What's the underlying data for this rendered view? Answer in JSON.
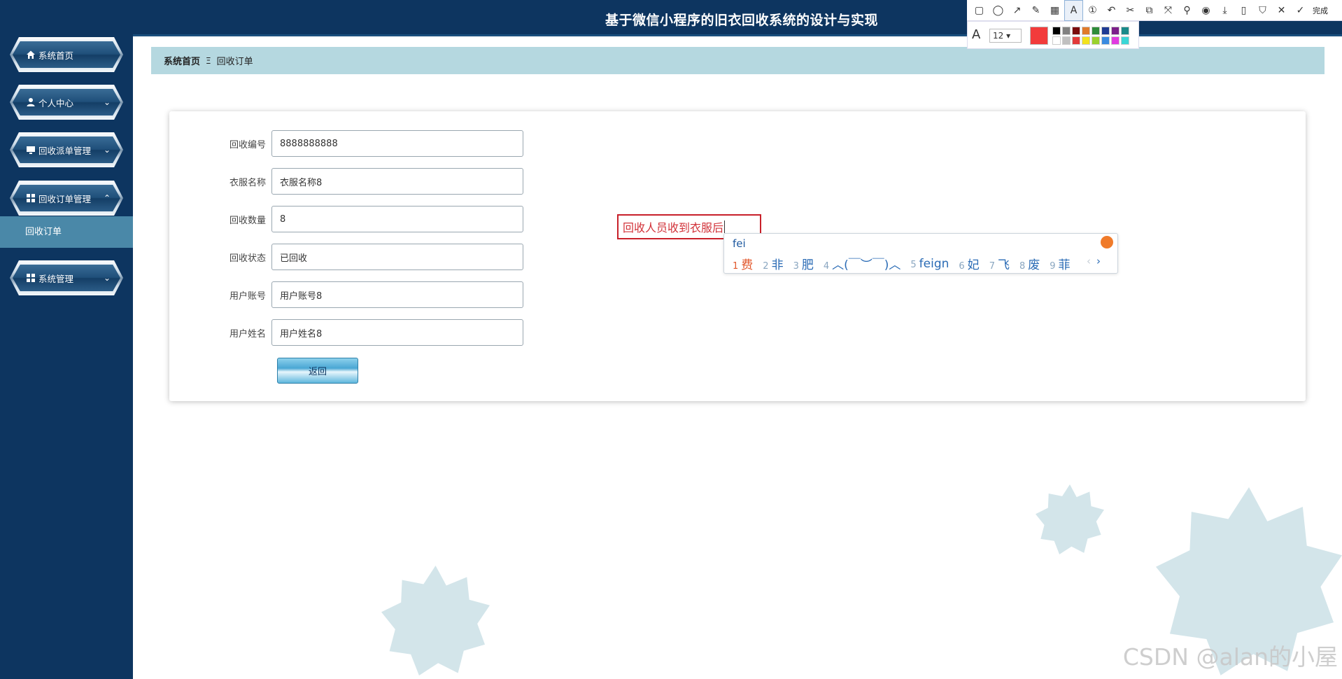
{
  "header": {
    "title": "基于微信小程序的旧衣回收系统的设计与实现"
  },
  "sidebar": {
    "items": [
      {
        "label": "系统首页",
        "icon": "home-icon"
      },
      {
        "label": "个人中心",
        "icon": "user-icon"
      },
      {
        "label": "回收派单管理",
        "icon": "monitor-icon"
      },
      {
        "label": "回收订单管理",
        "icon": "grid-icon"
      },
      {
        "label": "系统管理",
        "icon": "grid-icon"
      }
    ],
    "active_sub": "回收订单"
  },
  "breadcrumb": {
    "home": "系统首页",
    "separator": "Ξ",
    "current": "回收订单"
  },
  "form": {
    "fields": [
      {
        "label": "回收编号",
        "value": "8888888888"
      },
      {
        "label": "衣服名称",
        "value": "衣服名称8"
      },
      {
        "label": "回收数量",
        "value": "8"
      },
      {
        "label": "回收状态",
        "value": "已回收"
      },
      {
        "label": "用户账号",
        "value": "用户账号8"
      },
      {
        "label": "用户姓名",
        "value": "用户姓名8"
      }
    ],
    "back_label": "返回"
  },
  "annotation": {
    "text": "回收人员收到衣服后"
  },
  "ime": {
    "input": "fei",
    "candidates": [
      {
        "n": "1",
        "text": "费"
      },
      {
        "n": "2",
        "text": "非"
      },
      {
        "n": "3",
        "text": "肥"
      },
      {
        "n": "4",
        "text": "︿(￣︶￣)︿"
      },
      {
        "n": "5",
        "text": "feign"
      },
      {
        "n": "6",
        "text": "妃"
      },
      {
        "n": "7",
        "text": "飞"
      },
      {
        "n": "8",
        "text": "废"
      },
      {
        "n": "9",
        "text": "菲"
      }
    ],
    "prev": "‹",
    "next": "›"
  },
  "toolbar": {
    "done_label": "完成",
    "font_size": "12",
    "current_color": "#f23b3b"
  },
  "watermark": "CSDN @alan的小屋",
  "colors": {
    "sidebar": "#0d3560",
    "crumb": "#b5d8e0",
    "active_sub": "#4a88a8",
    "annotation": "#c8202a"
  }
}
